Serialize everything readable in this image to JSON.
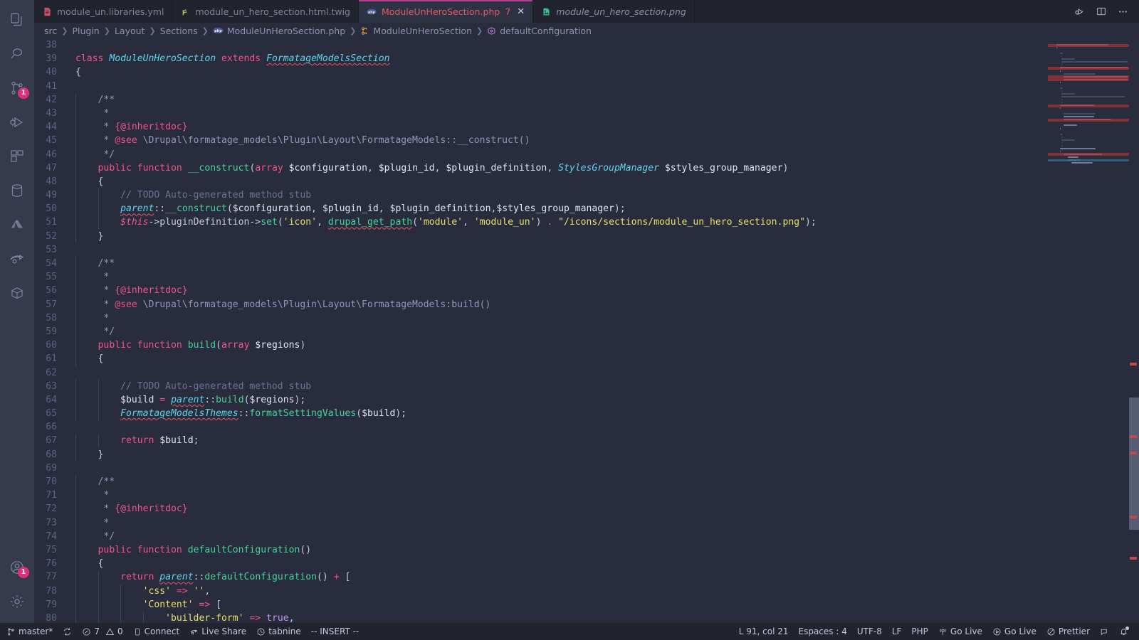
{
  "activity_bar": {
    "items": [
      {
        "name": "explorer",
        "icon": "files-icon",
        "badge": null,
        "active": false
      },
      {
        "name": "search",
        "icon": "search-icon",
        "badge": null,
        "active": false
      },
      {
        "name": "source-control",
        "icon": "source-control-icon",
        "badge": "1",
        "active": false
      },
      {
        "name": "run-and-debug",
        "icon": "run-debug-icon",
        "badge": null,
        "active": false
      },
      {
        "name": "extensions",
        "icon": "extensions-icon",
        "badge": null,
        "active": false
      },
      {
        "name": "database",
        "icon": "database-icon",
        "badge": null,
        "active": false
      },
      {
        "name": "azure",
        "icon": "azure-icon",
        "badge": null,
        "active": false
      },
      {
        "name": "live-share",
        "icon": "live-share-icon",
        "badge": null,
        "active": false
      },
      {
        "name": "docker",
        "icon": "docker-icon",
        "badge": null,
        "active": false
      }
    ],
    "bottom_items": [
      {
        "name": "accounts",
        "icon": "account-icon",
        "badge": "1"
      },
      {
        "name": "manage",
        "icon": "gear-icon",
        "badge": null
      }
    ]
  },
  "tabs": [
    {
      "label": "module_un.libraries.yml",
      "icon": "yaml-icon",
      "icon_color": "#e2586a",
      "active": false,
      "italic": false,
      "dirty": null,
      "closable": false
    },
    {
      "label": "module_un_hero_section.html.twig",
      "icon": "twig-icon",
      "icon_color": "#c8d44e",
      "active": false,
      "italic": false,
      "dirty": null,
      "closable": false
    },
    {
      "label": "ModuleUnHeroSection.php",
      "icon": "php-icon",
      "icon_color": "#4f5b93",
      "active": true,
      "italic": false,
      "dirty": "7",
      "closable": true
    },
    {
      "label": "module_un_hero_section.png",
      "icon": "image-icon",
      "icon_color": "#3ec98f",
      "active": false,
      "italic": true,
      "dirty": null,
      "closable": false
    }
  ],
  "tab_actions": [
    {
      "name": "run-or-debug",
      "icon": "run-debug-icon"
    },
    {
      "name": "split-editor",
      "icon": "split-editor-icon"
    },
    {
      "name": "more-actions",
      "icon": "ellipsis-icon"
    }
  ],
  "breadcrumbs": [
    {
      "label": "src",
      "icon": null
    },
    {
      "label": "Plugin",
      "icon": null
    },
    {
      "label": "Layout",
      "icon": null
    },
    {
      "label": "Sections",
      "icon": null
    },
    {
      "label": "ModuleUnHeroSection.php",
      "icon": "php-icon"
    },
    {
      "label": "ModuleUnHeroSection",
      "icon": "class-icon"
    },
    {
      "label": "defaultConfiguration",
      "icon": "method-icon"
    }
  ],
  "editor": {
    "first_line": 38,
    "last_line": 80,
    "language": "PHP",
    "lines": [
      {
        "n": 38,
        "text": ""
      },
      {
        "n": 39,
        "text": "class ModuleUnHeroSection extends FormatageModelsSection"
      },
      {
        "n": 40,
        "text": "{"
      },
      {
        "n": 41,
        "text": ""
      },
      {
        "n": 42,
        "text": "    /**"
      },
      {
        "n": 43,
        "text": "     *"
      },
      {
        "n": 44,
        "text": "     * {@inheritdoc}"
      },
      {
        "n": 45,
        "text": "     * @see \\Drupal\\formatage_models\\Plugin\\Layout\\FormatageModels::__construct()"
      },
      {
        "n": 46,
        "text": "     */"
      },
      {
        "n": 47,
        "text": "    public function __construct(array $configuration, $plugin_id, $plugin_definition, StylesGroupManager $styles_group_manager)"
      },
      {
        "n": 48,
        "text": "    {"
      },
      {
        "n": 49,
        "text": "        // TODO Auto-generated method stub"
      },
      {
        "n": 50,
        "text": "        parent::__construct($configuration, $plugin_id, $plugin_definition,$styles_group_manager);"
      },
      {
        "n": 51,
        "text": "        $this->pluginDefinition->set('icon', drupal_get_path('module', 'module_un') . \"/icons/sections/module_un_hero_section.png\");"
      },
      {
        "n": 52,
        "text": "    }"
      },
      {
        "n": 53,
        "text": ""
      },
      {
        "n": 54,
        "text": "    /**"
      },
      {
        "n": 55,
        "text": "     *"
      },
      {
        "n": 56,
        "text": "     * {@inheritdoc}"
      },
      {
        "n": 57,
        "text": "     * @see \\Drupal\\formatage_models\\Plugin\\Layout\\FormatageModels:build()"
      },
      {
        "n": 58,
        "text": "     *"
      },
      {
        "n": 59,
        "text": "     */"
      },
      {
        "n": 60,
        "text": "    public function build(array $regions)"
      },
      {
        "n": 61,
        "text": "    {"
      },
      {
        "n": 62,
        "text": ""
      },
      {
        "n": 63,
        "text": "        // TODO Auto-generated method stub"
      },
      {
        "n": 64,
        "text": "        $build = parent::build($regions);"
      },
      {
        "n": 65,
        "text": "        FormatageModelsThemes::formatSettingValues($build);"
      },
      {
        "n": 66,
        "text": ""
      },
      {
        "n": 67,
        "text": "        return $build;"
      },
      {
        "n": 68,
        "text": "    }"
      },
      {
        "n": 69,
        "text": ""
      },
      {
        "n": 70,
        "text": "    /**"
      },
      {
        "n": 71,
        "text": "     *"
      },
      {
        "n": 72,
        "text": "     * {@inheritdoc}"
      },
      {
        "n": 73,
        "text": "     *"
      },
      {
        "n": 74,
        "text": "     */"
      },
      {
        "n": 75,
        "text": "    public function defaultConfiguration()"
      },
      {
        "n": 76,
        "text": "    {"
      },
      {
        "n": 77,
        "text": "        return parent::defaultConfiguration() + ["
      },
      {
        "n": 78,
        "text": "            'css' => '',"
      },
      {
        "n": 79,
        "text": "            'Content' => ["
      },
      {
        "n": 80,
        "text": "                'builder-form' => true,"
      }
    ]
  },
  "status_bar": {
    "left": [
      {
        "name": "branch",
        "icon": "source-control-icon",
        "label": "master*"
      },
      {
        "name": "sync",
        "icon": "sync-icon",
        "label": ""
      },
      {
        "name": "problems",
        "icon": "error-icon",
        "label": "7",
        "icon2": "warning-icon",
        "label2": "0"
      },
      {
        "name": "remote",
        "icon": "remote-icon",
        "label": "Connect"
      },
      {
        "name": "live-share",
        "icon": "live-share-icon",
        "label": "Live Share"
      },
      {
        "name": "tabnine",
        "icon": "tabnine-icon",
        "label": "tabnine"
      },
      {
        "name": "vim-mode",
        "icon": null,
        "label": "-- INSERT --"
      }
    ],
    "right": [
      {
        "name": "cursor-position",
        "icon": null,
        "label": "L 91, col 21"
      },
      {
        "name": "indentation",
        "icon": null,
        "label": "Espaces : 4"
      },
      {
        "name": "encoding",
        "icon": null,
        "label": "UTF-8"
      },
      {
        "name": "eol",
        "icon": null,
        "label": "LF"
      },
      {
        "name": "language-mode",
        "icon": null,
        "label": "PHP"
      },
      {
        "name": "go-live-1",
        "icon": "broadcast-icon",
        "label": "Go Live"
      },
      {
        "name": "go-live-2",
        "icon": "play-circle-icon",
        "label": "Go Live"
      },
      {
        "name": "prettier",
        "icon": "prettier-icon",
        "label": "Prettier"
      },
      {
        "name": "feedback",
        "icon": "feedback-icon",
        "label": ""
      },
      {
        "name": "notifications",
        "icon": "bell-dot-icon",
        "label": ""
      }
    ]
  },
  "colors": {
    "editor_bg": "#282c3c",
    "activitybar_bg": "#353b4c",
    "tabsbar_bg": "#21242e",
    "active_tab_bg": "#2e3343",
    "active_tab_border": "#b4418f",
    "accent_pink": "#ff2e88",
    "error_red": "#e2586a",
    "keyword": "#f0558d",
    "class": "#61d4ea",
    "function": "#45d49a",
    "string": "#e8e06a",
    "comment": "#6b7494"
  }
}
